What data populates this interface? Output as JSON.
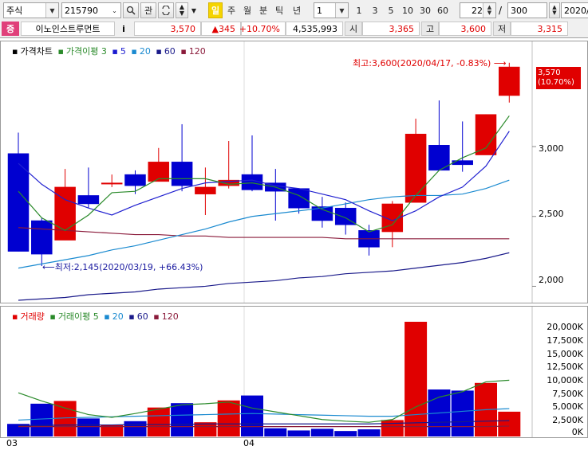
{
  "toolbar": {
    "market": "주식",
    "code": "215790",
    "period_tabs": [
      "일",
      "주",
      "월",
      "분",
      "틱",
      "년"
    ],
    "interval": "1",
    "quick_intervals": [
      "1",
      "3",
      "5",
      "10",
      "30",
      "60"
    ],
    "view_count": "22",
    "total_count": "300",
    "date": "2020/0",
    "search_label": "관"
  },
  "quote": {
    "badge": "증",
    "name": "이노인스트루먼트",
    "info_label": "i",
    "price": "3,570",
    "change": "▲345",
    "change_pct": "+10.70%",
    "volume": "4,535,993",
    "open_label": "시",
    "open": "3,365",
    "high_label": "고",
    "high": "3,600",
    "low_label": "저",
    "low": "3,315"
  },
  "price_panel": {
    "legend": [
      {
        "label": "가격차트",
        "color": "#000000"
      },
      {
        "label": "가격이평 3",
        "color": "#2a8a2a"
      },
      {
        "label": "5",
        "color": "#1a1ad0"
      },
      {
        "label": "20",
        "color": "#1a8ad0"
      },
      {
        "label": "60",
        "color": "#1a1a8a"
      },
      {
        "label": "120",
        "color": "#8a1a3a"
      }
    ],
    "max_annotation": "최고:3,600(2020/04/17, -0.83%)",
    "min_annotation": "최저:2,145(2020/03/19, +66.43%)",
    "current_price": "3,570",
    "current_pct": "(10.70%)",
    "y_ticks": [
      "3,000",
      "2,500",
      "2,000"
    ]
  },
  "volume_panel": {
    "legend": [
      {
        "label": "거래량",
        "color": "#e00000"
      },
      {
        "label": "거래이평 5",
        "color": "#2a8a2a"
      },
      {
        "label": "20",
        "color": "#1a8ad0"
      },
      {
        "label": "60",
        "color": "#1a1a8a"
      },
      {
        "label": "120",
        "color": "#8a1a3a"
      }
    ],
    "y_ticks": [
      "20,000K",
      "17,500K",
      "15,000K",
      "12,500K",
      "10,000K",
      "7,500K",
      "5,000K",
      "2,500K",
      "0K"
    ]
  },
  "x_axis_labels": [
    "03",
    "04"
  ],
  "chart_data": {
    "type": "candlestick",
    "candles": [
      {
        "o": 2950,
        "h": 3100,
        "l": 2250,
        "c": 2250,
        "v": 2300
      },
      {
        "o": 2470,
        "h": 2490,
        "l": 2145,
        "c": 2230,
        "v": 6000
      },
      {
        "o": 2330,
        "h": 2840,
        "l": 2330,
        "c": 2710,
        "v": 6500
      },
      {
        "o": 2650,
        "h": 2850,
        "l": 2560,
        "c": 2590,
        "v": 3300
      },
      {
        "o": 2740,
        "h": 2800,
        "l": 2710,
        "c": 2740,
        "v": 2100
      },
      {
        "o": 2800,
        "h": 2830,
        "l": 2660,
        "c": 2720,
        "v": 2800
      },
      {
        "o": 2750,
        "h": 2990,
        "l": 2750,
        "c": 2890,
        "v": 5300
      },
      {
        "o": 2890,
        "h": 3160,
        "l": 2680,
        "c": 2720,
        "v": 6100
      },
      {
        "o": 2660,
        "h": 2850,
        "l": 2510,
        "c": 2710,
        "v": 2600
      },
      {
        "o": 2720,
        "h": 3040,
        "l": 2700,
        "c": 2760,
        "v": 6600
      },
      {
        "o": 2800,
        "h": 3080,
        "l": 2680,
        "c": 2690,
        "v": 7500
      },
      {
        "o": 2740,
        "h": 2840,
        "l": 2470,
        "c": 2680,
        "v": 1500
      },
      {
        "o": 2700,
        "h": 2700,
        "l": 2520,
        "c": 2560,
        "v": 1100
      },
      {
        "o": 2570,
        "h": 2640,
        "l": 2420,
        "c": 2470,
        "v": 1400
      },
      {
        "o": 2560,
        "h": 2600,
        "l": 2370,
        "c": 2440,
        "v": 1000
      },
      {
        "o": 2400,
        "h": 2440,
        "l": 2220,
        "c": 2280,
        "v": 1300
      },
      {
        "o": 2390,
        "h": 2610,
        "l": 2280,
        "c": 2590,
        "v": 3000
      },
      {
        "o": 2600,
        "h": 3200,
        "l": 2600,
        "c": 3090,
        "v": 21000
      },
      {
        "o": 3010,
        "h": 3330,
        "l": 2840,
        "c": 2830,
        "v": 8600
      },
      {
        "o": 2900,
        "h": 3180,
        "l": 2820,
        "c": 2870,
        "v": 8400
      },
      {
        "o": 2940,
        "h": 3230,
        "l": 2940,
        "c": 3230,
        "v": 9800
      },
      {
        "o": 3365,
        "h": 3600,
        "l": 3315,
        "c": 3570,
        "v": 4535
      }
    ],
    "ma3": [
      2680,
      2490,
      2400,
      2510,
      2670,
      2680,
      2770,
      2770,
      2770,
      2730,
      2740,
      2710,
      2650,
      2550,
      2490,
      2390,
      2440,
      2650,
      2830,
      2920,
      2990,
      3220
    ],
    "ma5": [
      2880,
      2730,
      2620,
      2560,
      2510,
      2580,
      2640,
      2700,
      2740,
      2750,
      2760,
      2720,
      2700,
      2660,
      2620,
      2540,
      2470,
      2540,
      2640,
      2710,
      2860,
      3110
    ],
    "ma20": [
      2130,
      2160,
      2190,
      2220,
      2260,
      2290,
      2330,
      2370,
      2410,
      2460,
      2500,
      2520,
      2540,
      2560,
      2590,
      2620,
      2640,
      2650,
      2650,
      2660,
      2700,
      2760
    ],
    "ma60": [
      1900,
      1910,
      1920,
      1940,
      1950,
      1960,
      1980,
      1990,
      2000,
      2020,
      2030,
      2040,
      2060,
      2070,
      2090,
      2100,
      2110,
      2130,
      2150,
      2170,
      2200,
      2240
    ],
    "ma120": [
      2420,
      2410,
      2400,
      2390,
      2380,
      2370,
      2370,
      2360,
      2360,
      2350,
      2350,
      2350,
      2350,
      2350,
      2340,
      2340,
      2340,
      2340,
      2340,
      2340,
      2340,
      2340
    ],
    "vol_ma5": [
      8000,
      6500,
      5200,
      4000,
      3500,
      4200,
      5000,
      5800,
      6000,
      6300,
      5200,
      4500,
      3800,
      3100,
      2800,
      2600,
      3100,
      5400,
      7200,
      8200,
      10000,
      10300
    ],
    "vol_ma20": [
      3000,
      3200,
      3400,
      3500,
      3600,
      3700,
      3800,
      3900,
      4000,
      4100,
      4200,
      4100,
      4000,
      3900,
      3800,
      3700,
      3700,
      4000,
      4300,
      4600,
      4900,
      5100
    ],
    "vol_ma60": [
      2000,
      2000,
      2100,
      2100,
      2100,
      2200,
      2200,
      2200,
      2300,
      2300,
      2300,
      2300,
      2300,
      2300,
      2300,
      2300,
      2400,
      2500,
      2600,
      2700,
      2800,
      2900
    ],
    "vol_ma120": [
      1800,
      1800,
      1800,
      1800,
      1800,
      1800,
      1800,
      1800,
      1800,
      1800,
      1800,
      1800,
      1800,
      1800,
      1800,
      1800,
      1800,
      1800,
      1800,
      1800,
      1800,
      1900
    ],
    "price_ylim": [
      1900,
      3650
    ],
    "volume_ylim": [
      0,
      21000
    ],
    "x_labels": [
      "03",
      "04"
    ]
  }
}
